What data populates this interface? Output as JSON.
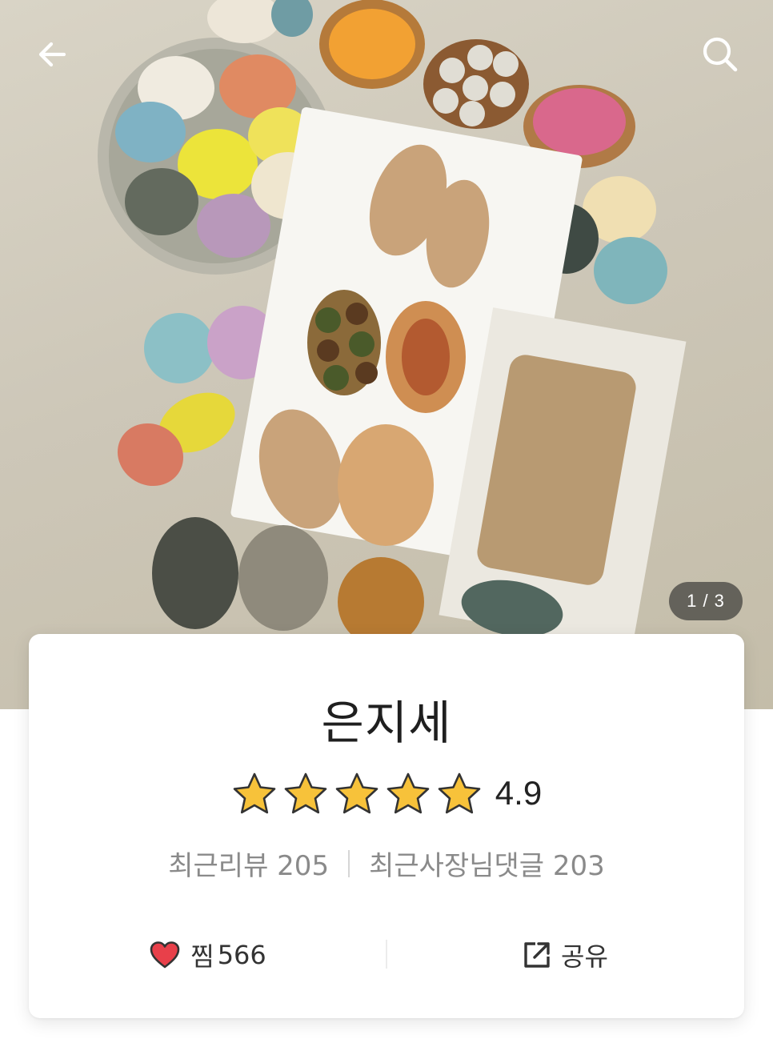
{
  "store": {
    "name": "은지세",
    "rating": "4.9",
    "rating_stars": 5,
    "recent_reviews": "최근리뷰 205",
    "owner_replies": "최근사장님댓글 203"
  },
  "gallery": {
    "counter": "1 / 3"
  },
  "actions": {
    "wish_label": "찜",
    "wish_count": "566",
    "share_label": "공유"
  },
  "icons": {
    "back": "arrow-left-icon",
    "search": "search-icon",
    "heart": "heart-icon",
    "share": "share-external-icon",
    "star": "star-icon"
  },
  "colors": {
    "star_fill": "#F7C23A",
    "heart_fill": "#E8404A"
  }
}
